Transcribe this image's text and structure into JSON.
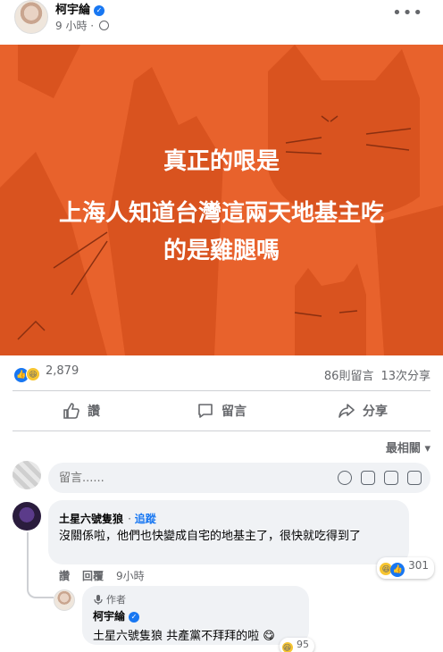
{
  "post": {
    "author": "柯宇綸",
    "time": "9 小時",
    "image_text": {
      "line1": "真正的哏是",
      "line2": "上海人知道台灣這兩天地基主吃",
      "line3": "的是雞腿嗎"
    },
    "colors": {
      "image_bg": "#e8622c",
      "cat_shapes": "#d9531f",
      "accent": "#1877f2"
    }
  },
  "stats": {
    "reaction_count": "2,879",
    "comments": "86則留言",
    "shares": "13次分享"
  },
  "actions": {
    "like": "讚",
    "comment": "留言",
    "share": "分享"
  },
  "sort": {
    "label": "最相關"
  },
  "composer": {
    "placeholder": "留言......"
  },
  "comments": [
    {
      "name": "土星六號隻狼",
      "follow": "追蹤",
      "text": "沒關係啦，他們也快變成自宅的地基主了，很快就吃得到了",
      "reaction_count": "301",
      "like_label": "讚",
      "reply_label": "回覆",
      "time": "9小時",
      "replies": [
        {
          "badge": "作者",
          "name": "柯宇綸",
          "text": "土星六號隻狼 共產黨不拜拜的啦",
          "reaction_count": "95"
        }
      ]
    }
  ]
}
